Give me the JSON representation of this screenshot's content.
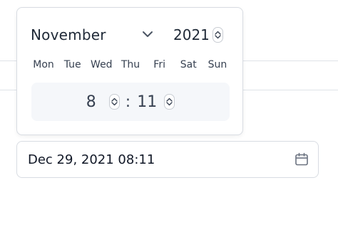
{
  "picker": {
    "month": "November",
    "year": "2021",
    "weekdays": [
      "Mon",
      "Tue",
      "Wed",
      "Thu",
      "Fri",
      "Sat",
      "Sun"
    ],
    "time": {
      "hour": "8",
      "separator": ":",
      "minute": "11"
    }
  },
  "field": {
    "value": "Dec 29, 2021 08:11"
  },
  "icons": {
    "month_dropdown": "chevron-down-icon",
    "year_stepper": "spin-stepper-icon",
    "calendar": "calendar-icon"
  },
  "colors": {
    "text": "#1f2937",
    "border": "#d8dce2",
    "time_panel_bg": "#f5f7fa"
  }
}
